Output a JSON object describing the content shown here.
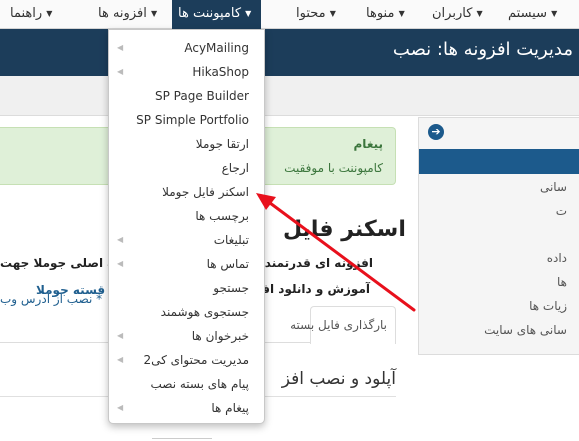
{
  "menubar": {
    "items": [
      {
        "label": "سیستم"
      },
      {
        "label": "کاربران"
      },
      {
        "label": "منوها"
      },
      {
        "label": "محتوا"
      },
      {
        "label": "کامپوننت ها"
      },
      {
        "label": "افزونه ها"
      },
      {
        "label": "راهنما"
      }
    ]
  },
  "header": {
    "title": "مدیریت افزونه ها: نصب"
  },
  "dropdown": {
    "items": [
      {
        "label": "AcyMailing",
        "submenu": true
      },
      {
        "label": "HikaShop",
        "submenu": true
      },
      {
        "label": "SP Page Builder",
        "submenu": false
      },
      {
        "label": "SP Simple Portfolio",
        "submenu": false
      },
      {
        "label": "ارتقا جوملا",
        "submenu": false
      },
      {
        "label": "ارجاع",
        "submenu": false
      },
      {
        "label": "اسکنر فایل جوملا",
        "submenu": false
      },
      {
        "label": "برچسب ها",
        "submenu": false
      },
      {
        "label": "تبلیغات",
        "submenu": true
      },
      {
        "label": "تماس ها",
        "submenu": true
      },
      {
        "label": "جستجو",
        "submenu": false
      },
      {
        "label": "جستجوی هوشمند",
        "submenu": false
      },
      {
        "label": "خبرخوان ها",
        "submenu": true
      },
      {
        "label": "مدیریت محتوای کی2",
        "submenu": true
      },
      {
        "label": "پیام های بسته نصب",
        "submenu": false
      },
      {
        "label": "پیغام ها",
        "submenu": true
      }
    ]
  },
  "message": {
    "heading": "پیغام",
    "body": "کامپوننت با موفقیت"
  },
  "main": {
    "heading": "اسکنر فایل",
    "line1": "افزونه ای قدرتمند ج",
    "line1_right": "ه اصلی جوملا جهت",
    "line2": "آموزش و دانلود افزو",
    "link": "قسته جوملا",
    "note": "* نصب از آدرس وب",
    "tab_label": "بارگذاری فایل بسته",
    "section_title": "آپلود و نصب افز"
  },
  "sidebar": {
    "items": [
      "سانی",
      "ت",
      "داده",
      "ها",
      "زیات ها",
      "سانی های سایت"
    ]
  },
  "colors": {
    "header": "#1c3d5a",
    "accent": "#1c5a8c",
    "arrow": "#e8101c"
  }
}
